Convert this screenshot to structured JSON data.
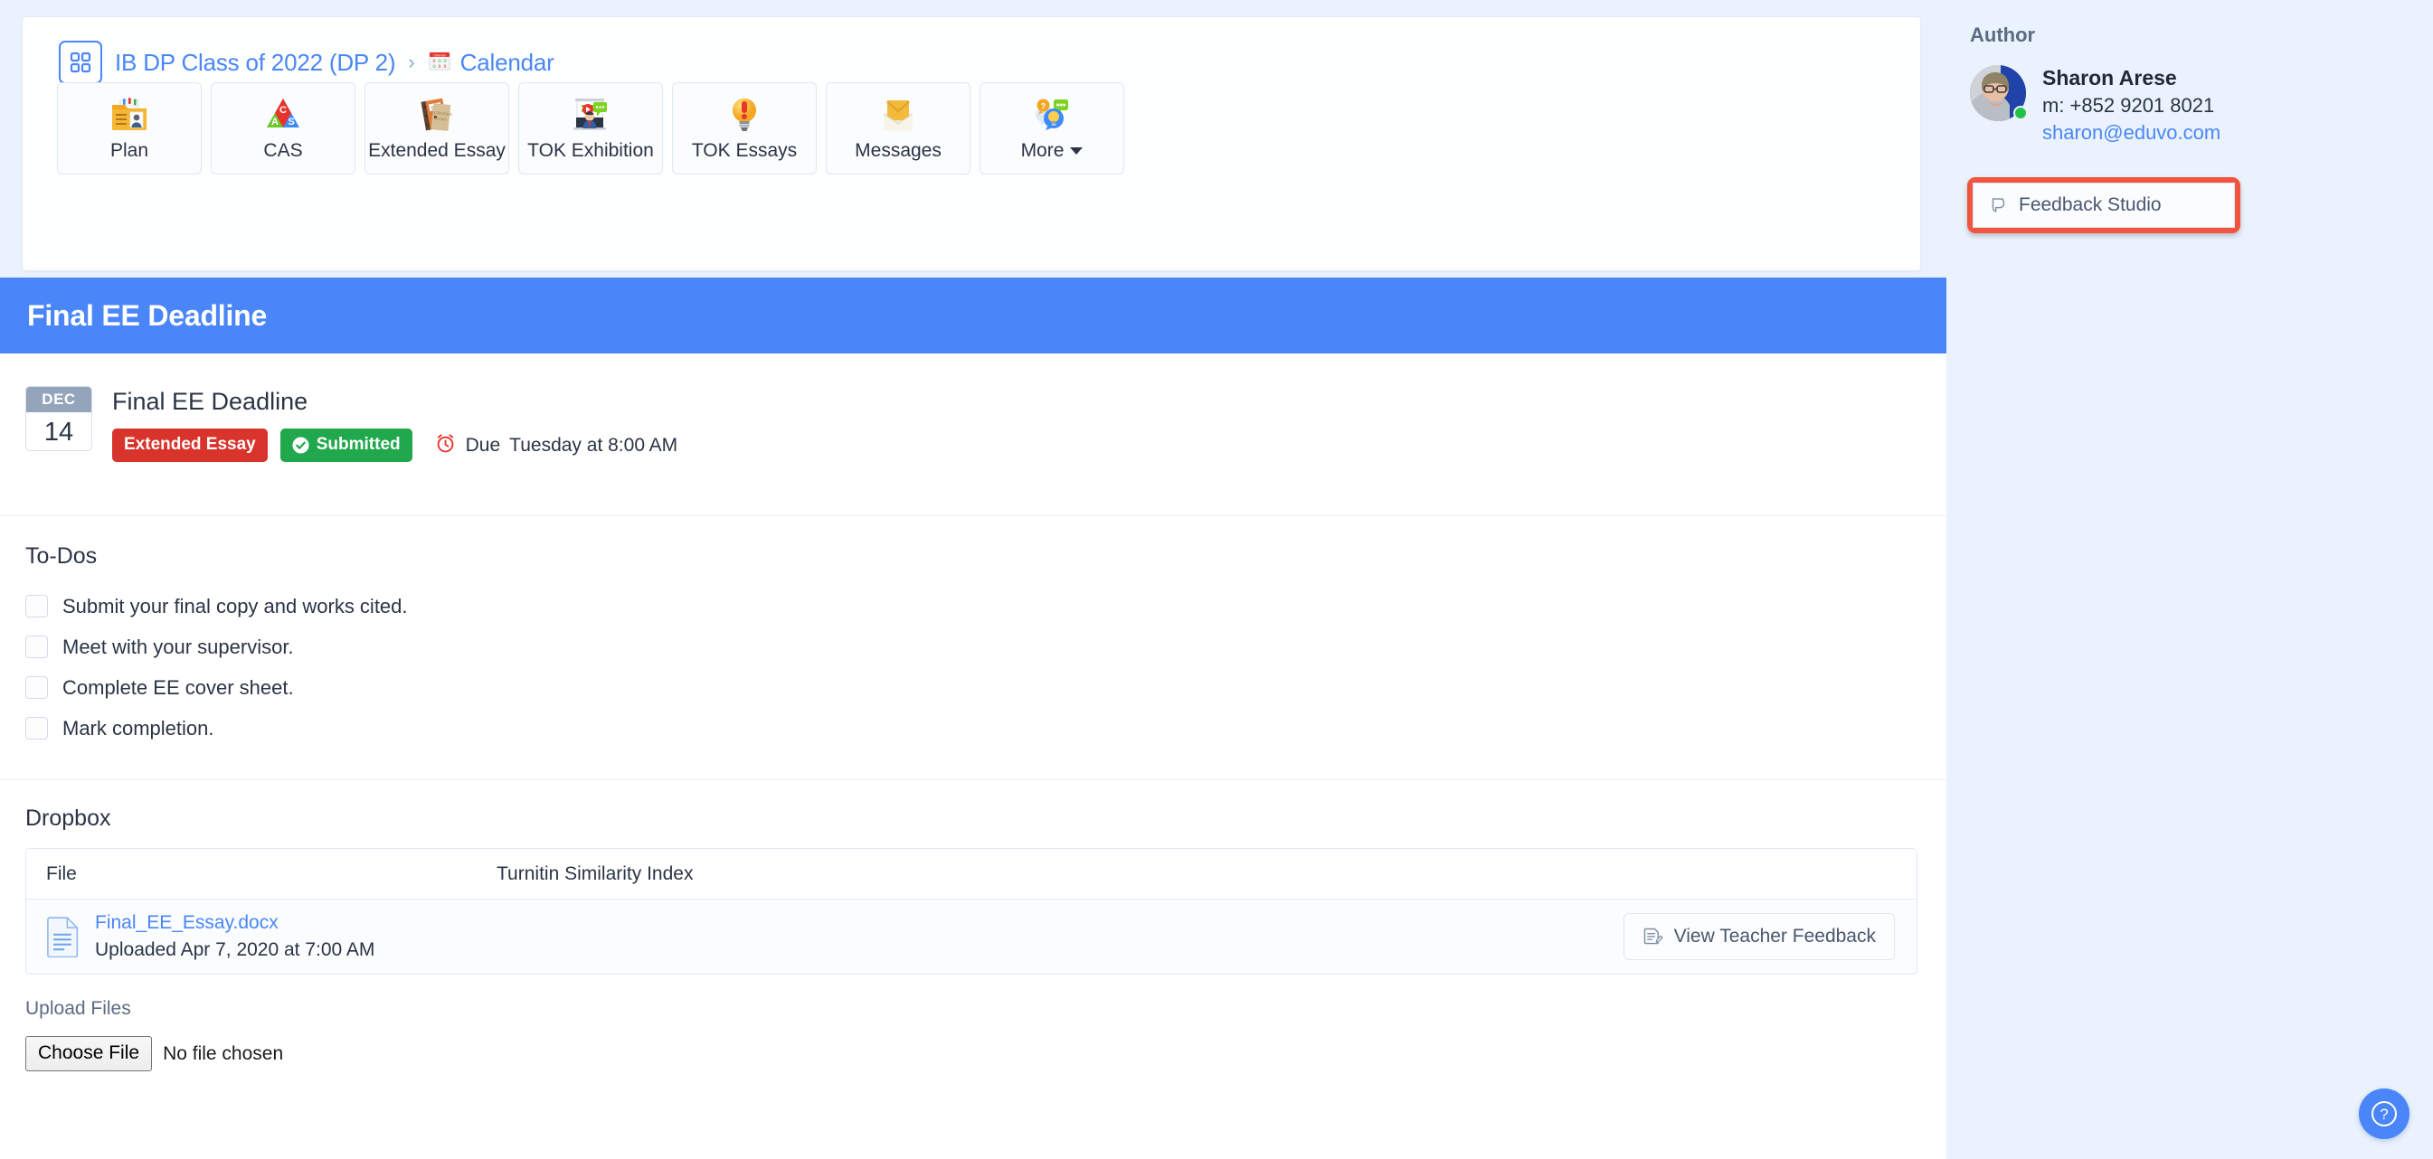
{
  "breadcrumb": {
    "grid_icon": "grid-apps-icon",
    "class_link": "IB DP Class of 2022 (DP 2)",
    "separator": "›",
    "calendar_icon": "calendar-icon",
    "calendar_link": "Calendar"
  },
  "tiles": [
    {
      "label": "Plan",
      "icon": "folder-portfolio-icon"
    },
    {
      "label": "CAS",
      "icon": "cas-triangle-icon"
    },
    {
      "label": "Extended Essay",
      "icon": "essay-books-icon"
    },
    {
      "label": "TOK Exhibition",
      "icon": "presentation-icon"
    },
    {
      "label": "TOK Essays",
      "icon": "lightbulb-alert-icon"
    },
    {
      "label": "Messages",
      "icon": "envelope-icon"
    },
    {
      "label": "More",
      "icon": "more-bubbles-icon",
      "has_caret": true
    }
  ],
  "banner": {
    "title": "Final EE Deadline",
    "color": "#4a86f7"
  },
  "event": {
    "month": "DEC",
    "day": "14",
    "name": "Final EE Deadline",
    "category": "Extended Essay",
    "category_color": "#d9342b",
    "status": "Submitted",
    "status_color": "#22a84c",
    "due_icon": "alarm-clock-icon",
    "due_label": "Due",
    "due_value": "Tuesday at 8:00 AM"
  },
  "todos": {
    "title": "To-Dos",
    "items": [
      "Submit your final copy and works cited.",
      "Meet with your supervisor.",
      "Complete EE cover sheet.",
      "Mark completion."
    ]
  },
  "dropbox": {
    "title": "Dropbox",
    "columns": [
      "File",
      "Turnitin Similarity Index"
    ],
    "rows": [
      {
        "file_icon": "document-icon",
        "file_name": "Final_EE_Essay.docx",
        "uploaded": "Uploaded Apr 7, 2020 at 7:00 AM",
        "similarity": "",
        "action_label": "View Teacher Feedback",
        "action_icon": "feedback-document-icon"
      }
    ]
  },
  "upload": {
    "label": "Upload Files",
    "button_label": "Choose File",
    "status": "No file chosen"
  },
  "sidebar": {
    "author_title": "Author",
    "avatar_icon": "user-avatar",
    "online_status": "online",
    "name": "Sharon Arese",
    "phone": "m: +852 9201 8021",
    "email": "sharon@eduvo.com",
    "feedback_studio": {
      "label": "Feedback Studio",
      "icon": "turnitin-icon",
      "highlight_color": "#f1543f"
    }
  },
  "help": {
    "icon": "question-mark-icon",
    "color": "#4a86f7"
  }
}
